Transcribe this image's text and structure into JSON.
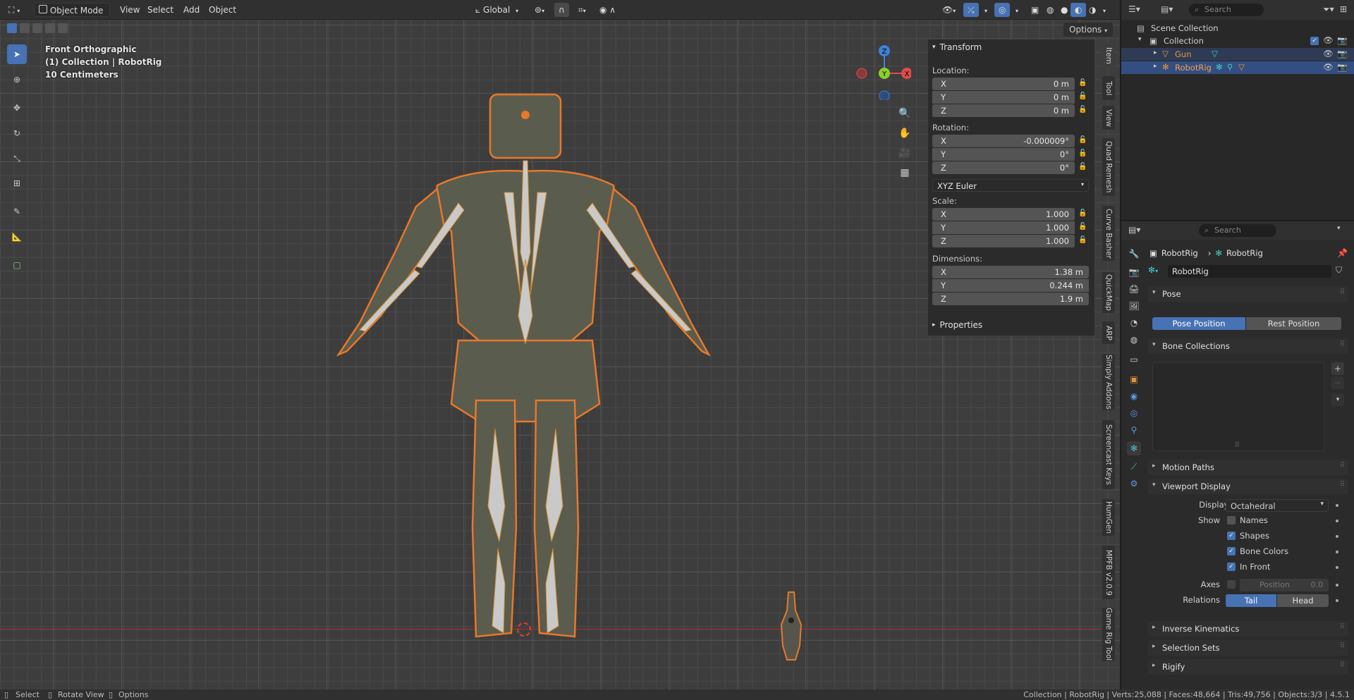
{
  "header": {
    "mode": "Object Mode",
    "menus": [
      "View",
      "Select",
      "Add",
      "Object"
    ],
    "orientation": "Global",
    "options": "Options"
  },
  "viewport": {
    "view_name": "Front Orthographic",
    "collection_info": "(1) Collection | RobotRig",
    "scale_info": "10 Centimeters",
    "gizmo": {
      "z": "Z",
      "y": "Y",
      "x": "X"
    }
  },
  "npanel": {
    "transform_title": "Transform",
    "location_label": "Location:",
    "location": [
      {
        "axis": "X",
        "value": "0 m"
      },
      {
        "axis": "Y",
        "value": "0 m"
      },
      {
        "axis": "Z",
        "value": "0 m"
      }
    ],
    "rotation_label": "Rotation:",
    "rotation": [
      {
        "axis": "X",
        "value": "-0.000009°"
      },
      {
        "axis": "Y",
        "value": "0°"
      },
      {
        "axis": "Z",
        "value": "0°"
      }
    ],
    "rotation_mode": "XYZ Euler",
    "scale_label": "Scale:",
    "scale": [
      {
        "axis": "X",
        "value": "1.000"
      },
      {
        "axis": "Y",
        "value": "1.000"
      },
      {
        "axis": "Z",
        "value": "1.000"
      }
    ],
    "dimensions_label": "Dimensions:",
    "dimensions": [
      {
        "axis": "X",
        "value": "1.38 m"
      },
      {
        "axis": "Y",
        "value": "0.244 m"
      },
      {
        "axis": "Z",
        "value": "1.9 m"
      }
    ],
    "properties_title": "Properties",
    "tabs": [
      "Item",
      "Tool",
      "View",
      "Quad Remesh",
      "Curve Basher",
      "QuickMap",
      "ARP",
      "Simply Addons",
      "Screencast Keys",
      "HumGen",
      "MPFB v2.0.9",
      "Game Rig Tool"
    ]
  },
  "outliner": {
    "search_placeholder": "Search",
    "scene_collection": "Scene Collection",
    "collection": "Collection",
    "items": [
      {
        "name": "Gun"
      },
      {
        "name": "RobotRig"
      }
    ]
  },
  "properties": {
    "search_placeholder": "Search",
    "breadcrumb_1": "RobotRig",
    "breadcrumb_2": "RobotRig",
    "datablock_name": "RobotRig",
    "pose": {
      "title": "Pose",
      "pose_position": "Pose Position",
      "rest_position": "Rest Position"
    },
    "bone_collections": {
      "title": "Bone Collections"
    },
    "motion_paths": {
      "title": "Motion Paths"
    },
    "viewport_display": {
      "title": "Viewport Display",
      "display_as_label": "Display As",
      "display_as_value": "Octahedral",
      "show_label": "Show",
      "names": "Names",
      "shapes": "Shapes",
      "bone_colors": "Bone Colors",
      "in_front": "In Front",
      "axes_label": "Axes",
      "position_label": "Position",
      "position_value": "0.0",
      "relations_label": "Relations",
      "tail": "Tail",
      "head": "Head"
    },
    "inverse_kinematics": {
      "title": "Inverse Kinematics"
    },
    "selection_sets": {
      "title": "Selection Sets"
    },
    "rigify": {
      "title": "Rigify"
    }
  },
  "statusbar": {
    "select": "Select",
    "rotate_view": "Rotate View",
    "options": "Options",
    "stats": "Collection | RobotRig | Verts:25,088 | Faces:48,664 | Tris:49,756 | Objects:3/3 | 4.5.1"
  },
  "colors": {
    "accent": "#4772b3",
    "selection_outline": "#e8782a",
    "x_axis": "#e04c4c",
    "y_axis": "#8ccf2a",
    "z_axis": "#3d82d6"
  }
}
